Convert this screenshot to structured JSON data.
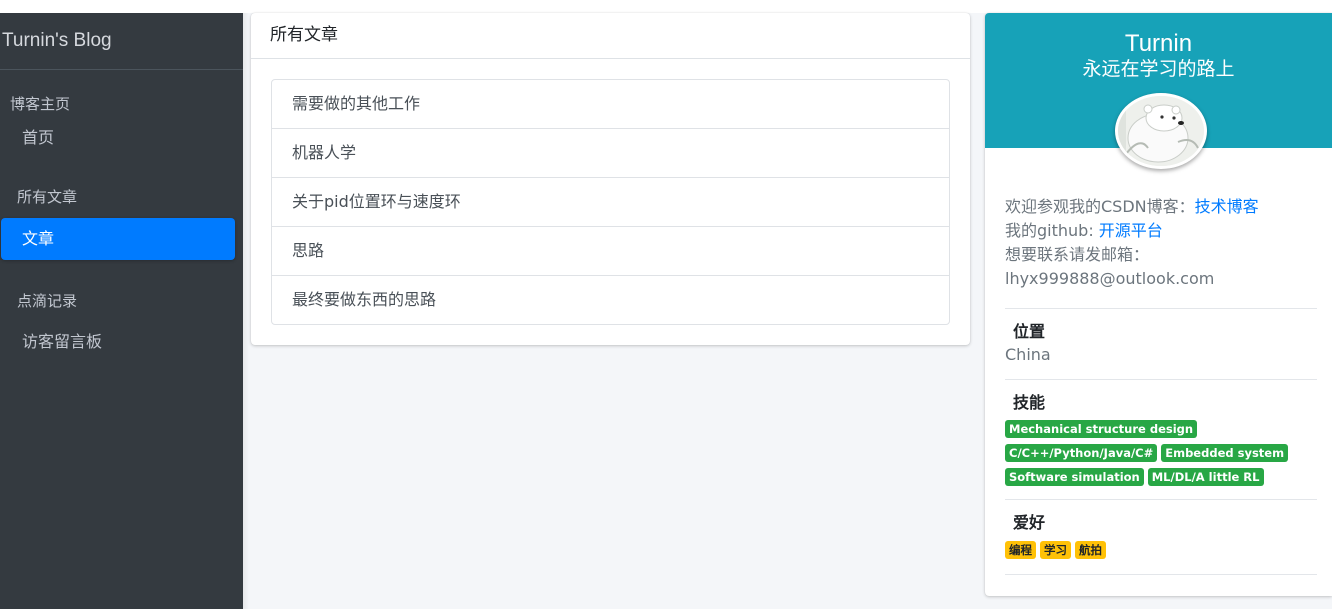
{
  "brand": {
    "title": "Turnin's Blog"
  },
  "sidebar": {
    "header1": "博客主页",
    "link_home": "首页",
    "header2": "所有文章",
    "link_articles": "文章",
    "header3": "点滴记录",
    "link_guestbook": "访客留言板"
  },
  "main": {
    "card_title": "所有文章",
    "articles": [
      "需要做的其他工作",
      "机器人学",
      "关于pid位置环与速度环",
      "思路",
      "最终要做东西的思路"
    ]
  },
  "profile": {
    "name": "Turnin",
    "motto": "永远在学习的路上",
    "csdn_prefix": "欢迎参观我的CSDN博客：",
    "csdn_link": "技术博客",
    "github_prefix": "我的github: ",
    "github_link": "开源平台",
    "email_prefix": "想要联系请发邮箱：",
    "email": "lhyx999888@outlook.com",
    "location_title": "位置",
    "location": "China",
    "skills_title": "技能",
    "skills": [
      "Mechanical structure design",
      "C/C++/Python/Java/C#",
      "Embedded system",
      "Software simulation",
      "ML/DL/A little RL"
    ],
    "hobbies_title": "爱好",
    "hobbies": [
      "编程",
      "学习",
      "航拍"
    ]
  },
  "colors": {
    "sidebar_bg": "#343a40",
    "active": "#007bff",
    "profile_header": "#17a2b8",
    "skill_badge": "#28a745",
    "hobby_badge": "#ffc107"
  }
}
